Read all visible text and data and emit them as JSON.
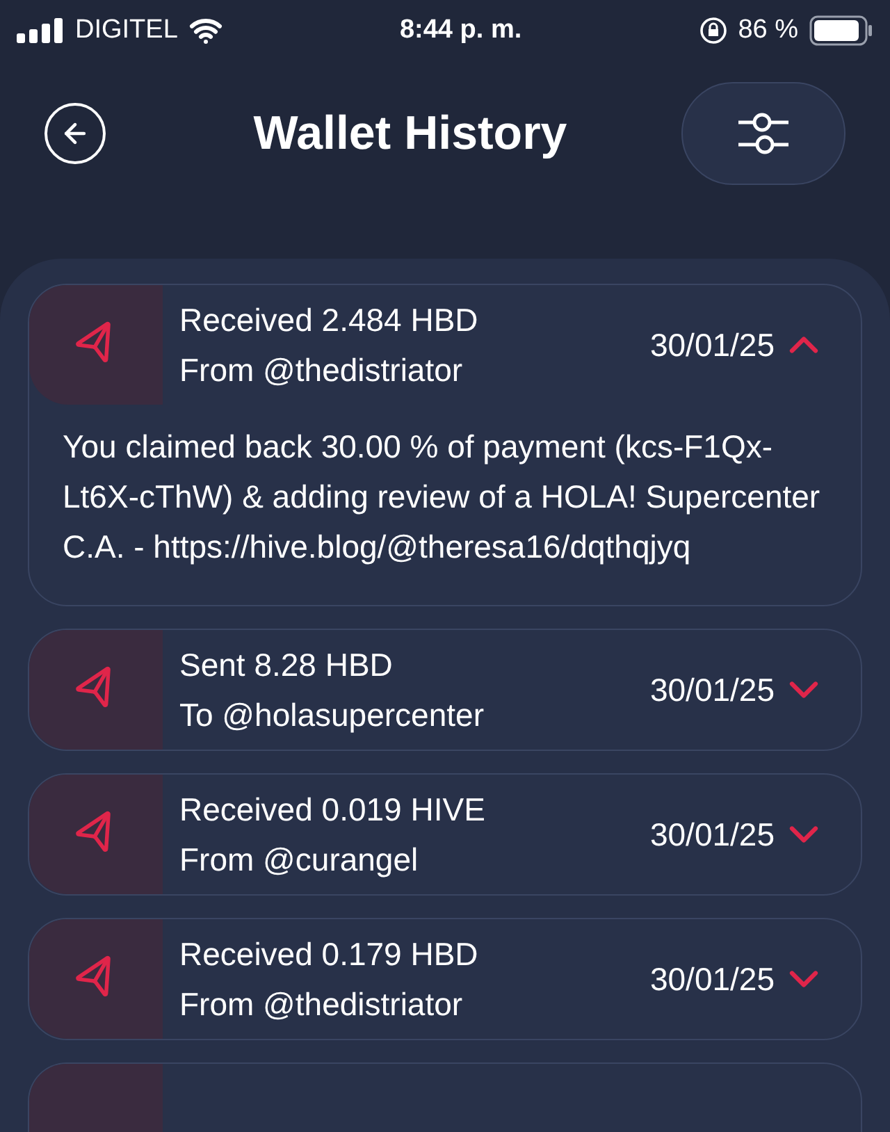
{
  "status_bar": {
    "carrier": "DIGITEL",
    "time": "8:44 p. m.",
    "battery": "86 %"
  },
  "header": {
    "title": "Wallet History"
  },
  "transactions": [
    {
      "kind": "full",
      "title": "Received 2.484 HBD",
      "counterpart": "From @thedistriator",
      "date": "30/01/25",
      "expanded": true,
      "memo": "You claimed back 30.00 % of payment (kcs-F1Qx-Lt6X-cThW) & adding review of a HOLA! Supercenter C.A. - https://hive.blog/@theresa16/dqthqjyq"
    },
    {
      "kind": "full",
      "title": "Sent 8.28 HBD",
      "counterpart": "To @holasupercenter",
      "date": "30/01/25",
      "expanded": false
    },
    {
      "kind": "full",
      "title": "Received 0.019 HIVE",
      "counterpart": "From @curangel",
      "date": "30/01/25",
      "expanded": false
    },
    {
      "kind": "full",
      "title": "Received 0.179 HBD",
      "counterpart": "From @thedistriator",
      "date": "30/01/25",
      "expanded": false
    },
    {
      "kind": "cut"
    }
  ]
}
